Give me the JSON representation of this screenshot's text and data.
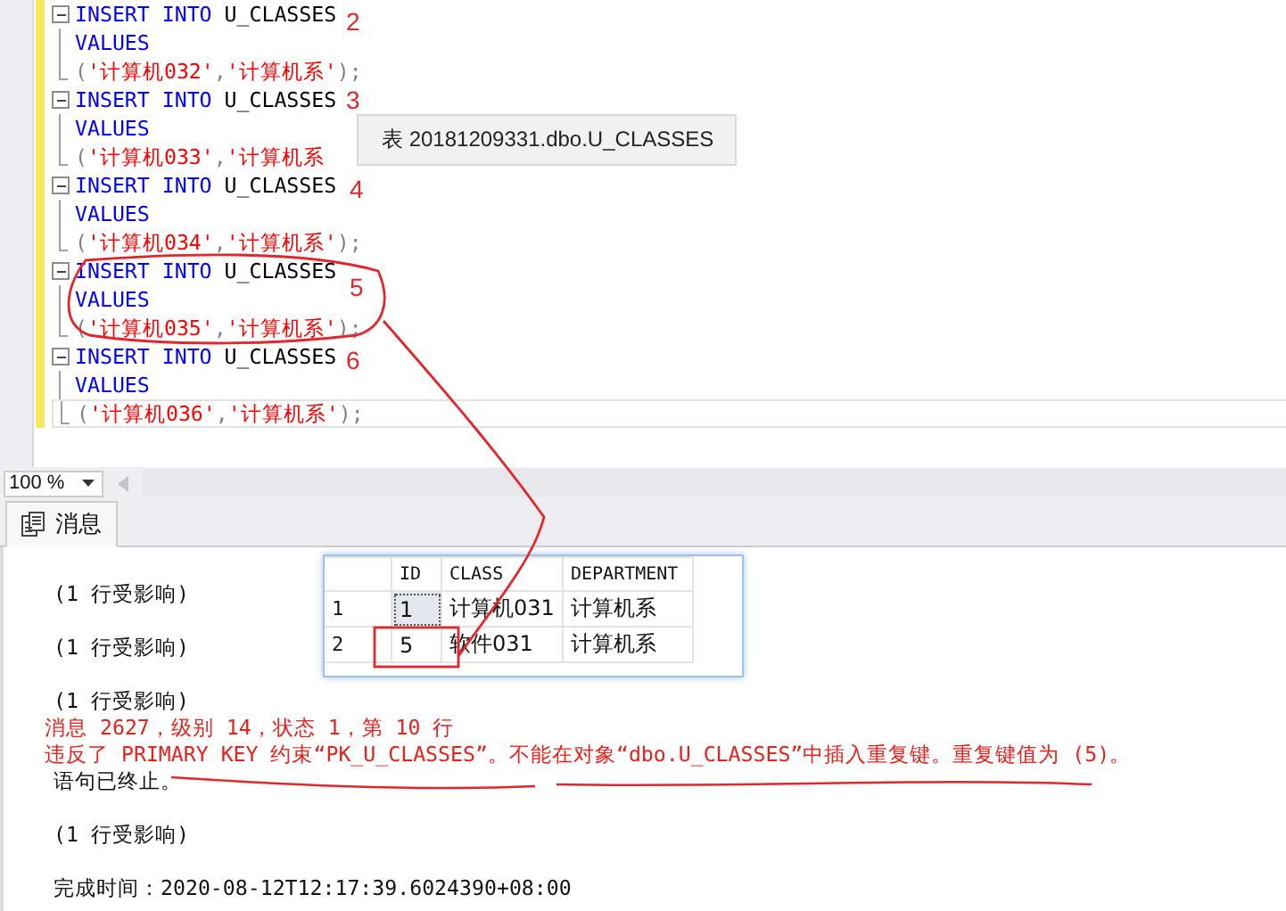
{
  "editor": {
    "statements": [
      {
        "insert": "INSERT INTO",
        "table": "U_CLASSES",
        "keyword": "VALUES",
        "values": "('计算机032','计算机系');",
        "note": "2"
      },
      {
        "insert": "INSERT INTO",
        "table": "U_CLASSES",
        "keyword": "VALUES",
        "values": "('计算机033','计算机系",
        "note": "3"
      },
      {
        "insert": "INSERT INTO",
        "table": "U_CLASSES",
        "keyword": "VALUES",
        "values": "('计算机034','计算机系');",
        "note": "4"
      },
      {
        "insert": "INSERT INTO",
        "table": "U_CLASSES",
        "keyword": "VALUES",
        "values": "('计算机035','计算机系');",
        "note": "5"
      },
      {
        "insert": "INSERT INTO",
        "table": "U_CLASSES",
        "keyword": "VALUES",
        "values": "('计算机036','计算机系');",
        "note": "6"
      }
    ],
    "tooltip": "表 20181209331.dbo.U_CLASSES"
  },
  "zoom": {
    "value": "100 %"
  },
  "tabs": [
    {
      "label": "消息",
      "selected": true
    }
  ],
  "message_blocks": [
    {
      "lines": [
        {
          "kind": "info",
          "text": "(1 行受影响)"
        }
      ]
    },
    {
      "lines": [
        {
          "kind": "info",
          "text": "(1 行受影响)"
        }
      ]
    },
    {
      "lines": [
        {
          "kind": "info",
          "text": "(1 行受影响)"
        },
        {
          "kind": "error",
          "text": "消息 2627，级别 14，状态 1，第 10 行"
        },
        {
          "kind": "error",
          "text": "违反了 PRIMARY KEY 约束“PK_U_CLASSES”。不能在对象“dbo.U_CLASSES”中插入重复键。重复键值为 (5)。"
        },
        {
          "kind": "info",
          "text": "语句已终止。"
        }
      ]
    },
    {
      "lines": [
        {
          "kind": "info",
          "text": "(1 行受影响)"
        }
      ]
    },
    {
      "lines": [
        {
          "kind": "info",
          "text": "完成时间：2020-08-12T12:17:39.6024390+08:00"
        }
      ]
    }
  ],
  "result_grid": {
    "columns": [
      "ID",
      "CLASS",
      "DEPARTMENT"
    ],
    "rows": [
      {
        "number": "1",
        "cells": [
          {
            "text": "1",
            "focused": true
          },
          {
            "text": "计算机031",
            "focused": false
          },
          {
            "text": "计算机系",
            "focused": false
          }
        ]
      },
      {
        "number": "2",
        "cells": [
          {
            "text": "5",
            "focused": false
          },
          {
            "text": "软件031",
            "focused": false
          },
          {
            "text": "计算机系",
            "focused": false
          }
        ]
      }
    ]
  }
}
